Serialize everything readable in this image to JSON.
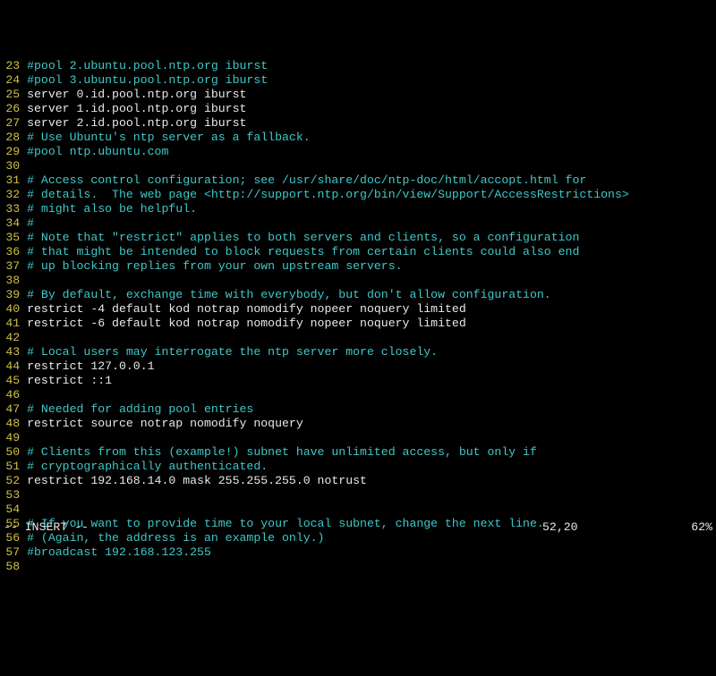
{
  "lines": [
    {
      "n": 23,
      "cls": "comment",
      "t": "#pool 2.ubuntu.pool.ntp.org iburst"
    },
    {
      "n": 24,
      "cls": "comment",
      "t": "#pool 3.ubuntu.pool.ntp.org iburst"
    },
    {
      "n": 25,
      "cls": "code",
      "t": "server 0.id.pool.ntp.org iburst"
    },
    {
      "n": 26,
      "cls": "code",
      "t": "server 1.id.pool.ntp.org iburst"
    },
    {
      "n": 27,
      "cls": "code",
      "t": "server 2.id.pool.ntp.org iburst"
    },
    {
      "n": 28,
      "cls": "comment",
      "t": "# Use Ubuntu's ntp server as a fallback."
    },
    {
      "n": 29,
      "cls": "comment",
      "t": "#pool ntp.ubuntu.com"
    },
    {
      "n": 30,
      "cls": "code",
      "t": ""
    },
    {
      "n": 31,
      "cls": "comment",
      "t": "# Access control configuration; see /usr/share/doc/ntp-doc/html/accopt.html for"
    },
    {
      "n": 32,
      "cls": "comment",
      "t": "# details.  The web page <http://support.ntp.org/bin/view/Support/AccessRestrictions>"
    },
    {
      "n": 33,
      "cls": "comment",
      "t": "# might also be helpful."
    },
    {
      "n": 34,
      "cls": "comment",
      "t": "#"
    },
    {
      "n": 35,
      "cls": "comment",
      "t": "# Note that \"restrict\" applies to both servers and clients, so a configuration"
    },
    {
      "n": 36,
      "cls": "comment",
      "t": "# that might be intended to block requests from certain clients could also end"
    },
    {
      "n": 37,
      "cls": "comment",
      "t": "# up blocking replies from your own upstream servers."
    },
    {
      "n": 38,
      "cls": "code",
      "t": ""
    },
    {
      "n": 39,
      "cls": "comment",
      "t": "# By default, exchange time with everybody, but don't allow configuration."
    },
    {
      "n": 40,
      "cls": "code",
      "t": "restrict -4 default kod notrap nomodify nopeer noquery limited"
    },
    {
      "n": 41,
      "cls": "code",
      "t": "restrict -6 default kod notrap nomodify nopeer noquery limited"
    },
    {
      "n": 42,
      "cls": "code",
      "t": ""
    },
    {
      "n": 43,
      "cls": "comment",
      "t": "# Local users may interrogate the ntp server more closely."
    },
    {
      "n": 44,
      "cls": "code",
      "t": "restrict 127.0.0.1"
    },
    {
      "n": 45,
      "cls": "code",
      "t": "restrict ::1"
    },
    {
      "n": 46,
      "cls": "code",
      "t": ""
    },
    {
      "n": 47,
      "cls": "comment",
      "t": "# Needed for adding pool entries"
    },
    {
      "n": 48,
      "cls": "code",
      "t": "restrict source notrap nomodify noquery"
    },
    {
      "n": 49,
      "cls": "code",
      "t": ""
    },
    {
      "n": 50,
      "cls": "comment",
      "t": "# Clients from this (example!) subnet have unlimited access, but only if"
    },
    {
      "n": 51,
      "cls": "comment",
      "t": "# cryptographically authenticated."
    },
    {
      "n": 52,
      "cls": "code",
      "t": "restrict 192.168.14.0 mask 255.255.255.0 notrust"
    },
    {
      "n": 53,
      "cls": "code",
      "t": ""
    },
    {
      "n": 54,
      "cls": "code",
      "t": ""
    },
    {
      "n": 55,
      "cls": "comment",
      "t": "# If you want to provide time to your local subnet, change the next line."
    },
    {
      "n": 56,
      "cls": "comment",
      "t": "# (Again, the address is an example only.)"
    },
    {
      "n": 57,
      "cls": "comment",
      "t": "#broadcast 192.168.123.255"
    },
    {
      "n": 58,
      "cls": "code",
      "t": ""
    }
  ],
  "status": {
    "mode": "-- INSERT --",
    "position": "52,20",
    "percent": "62%"
  }
}
